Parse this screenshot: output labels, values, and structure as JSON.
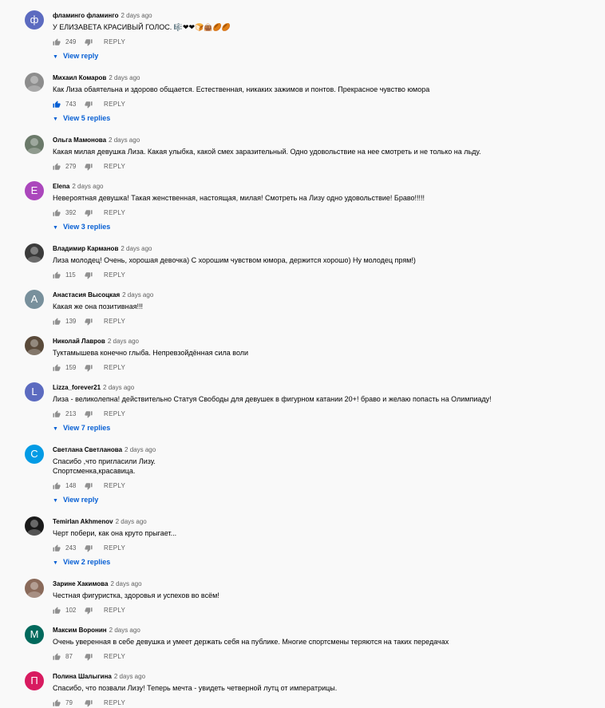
{
  "reply_label": "REPLY",
  "comments": [
    {
      "author": "фламинго фламинго",
      "time": "2 days ago",
      "text": [
        "У ЕЛИЗАВЕТА КРАСИВЫЙ ГОЛОС. 🎼❤❤🍞👜🏉🏉"
      ],
      "likes": "249",
      "replies": "View reply",
      "avatar": {
        "letter": "ф",
        "color": "#5c6bc0"
      }
    },
    {
      "author": "Михаил Комаров",
      "time": "2 days ago",
      "text": [
        "Как Лиза обаятельна и здорово общается. Естественная, никаких зажимов и понтов. Прекрасное чувство юмора"
      ],
      "likes": "743",
      "replies": "View 5 replies",
      "avatar": {
        "letter": "",
        "color": "#8d8d8d"
      },
      "liked": true
    },
    {
      "author": "Ольга Мамонова",
      "time": "2 days ago",
      "text": [
        "Какая милая девушка Лиза. Какая улыбка, какой смех заразительный. Одно удовольствие на нее смотреть и не только на льду."
      ],
      "likes": "279",
      "replies": "",
      "avatar": {
        "letter": "",
        "color": "#6b7a6a"
      }
    },
    {
      "author": "Elena",
      "time": "2 days ago",
      "text": [
        "Невероятная девушка! Такая женственная, настоящая, милая! Смотреть на Лизу одно удовольствие! Браво!!!!!"
      ],
      "likes": "392",
      "replies": "View 3 replies",
      "avatar": {
        "letter": "E",
        "color": "#ab47bc"
      }
    },
    {
      "author": "Владимир Карманов",
      "time": "2 days ago",
      "text": [
        "Лиза молодец! Очень, хорошая девочка) С хорошим чувством юмора, держится хорошо) Ну молодец прям!)"
      ],
      "likes": "115",
      "replies": "",
      "avatar": {
        "letter": "",
        "color": "#3b3b3b"
      }
    },
    {
      "author": "Анастасия Высоцкая",
      "time": "2 days ago",
      "text": [
        "Какая же она позитивная!!!"
      ],
      "likes": "139",
      "replies": "",
      "avatar": {
        "letter": "A",
        "color": "#78909c"
      }
    },
    {
      "author": "Николай Лавров",
      "time": "2 days ago",
      "text": [
        "Туктамышева конечно глыба. Непревзойдённая сила воли"
      ],
      "likes": "159",
      "replies": "",
      "avatar": {
        "letter": "",
        "color": "#5a4a3a"
      }
    },
    {
      "author": "Lizza_forever21",
      "time": "2 days ago",
      "text": [
        "Лиза - великолепна! действительно Статуя Свободы для девушек в фигурном катании 20+! браво и желаю попасть на Олимпиаду!"
      ],
      "likes": "213",
      "replies": "View 7 replies",
      "avatar": {
        "letter": "L",
        "color": "#5c6bc0"
      }
    },
    {
      "author": "Светлана Светланова",
      "time": "2 days ago",
      "text": [
        "Спасибо ,что пригласили Лизу.",
        "Спортсменка,красавица."
      ],
      "likes": "148",
      "replies": "View reply",
      "avatar": {
        "letter": "C",
        "color": "#039be5"
      }
    },
    {
      "author": "Temirlan Akhmenov",
      "time": "2 days ago",
      "text": [
        "Черт побери, как она круто прыгает..."
      ],
      "likes": "243",
      "replies": "View 2 replies",
      "avatar": {
        "letter": "",
        "color": "#1a1a1a"
      }
    },
    {
      "author": "Зарине Хакимова",
      "time": "2 days ago",
      "text": [
        "Честная фигуристка, здоровья и успехов во всём!"
      ],
      "likes": "102",
      "replies": "",
      "avatar": {
        "letter": "",
        "color": "#8a6a5a"
      }
    },
    {
      "author": "Максим Воронин",
      "time": "2 days ago",
      "text": [
        "Очень уверенная в себе девушка и умеет держать себя на публике. Многие спортсмены теряются на таких передачах"
      ],
      "likes": "87",
      "replies": "",
      "avatar": {
        "letter": "M",
        "color": "#00695c"
      }
    },
    {
      "author": "Полина Шалыгина",
      "time": "2 days ago",
      "text": [
        "Спасибо, что позвали Лизу! Теперь мечта - увидеть четверной лутц от императрицы."
      ],
      "likes": "79",
      "replies": "",
      "avatar": {
        "letter": "П",
        "color": "#d81b60"
      }
    }
  ]
}
